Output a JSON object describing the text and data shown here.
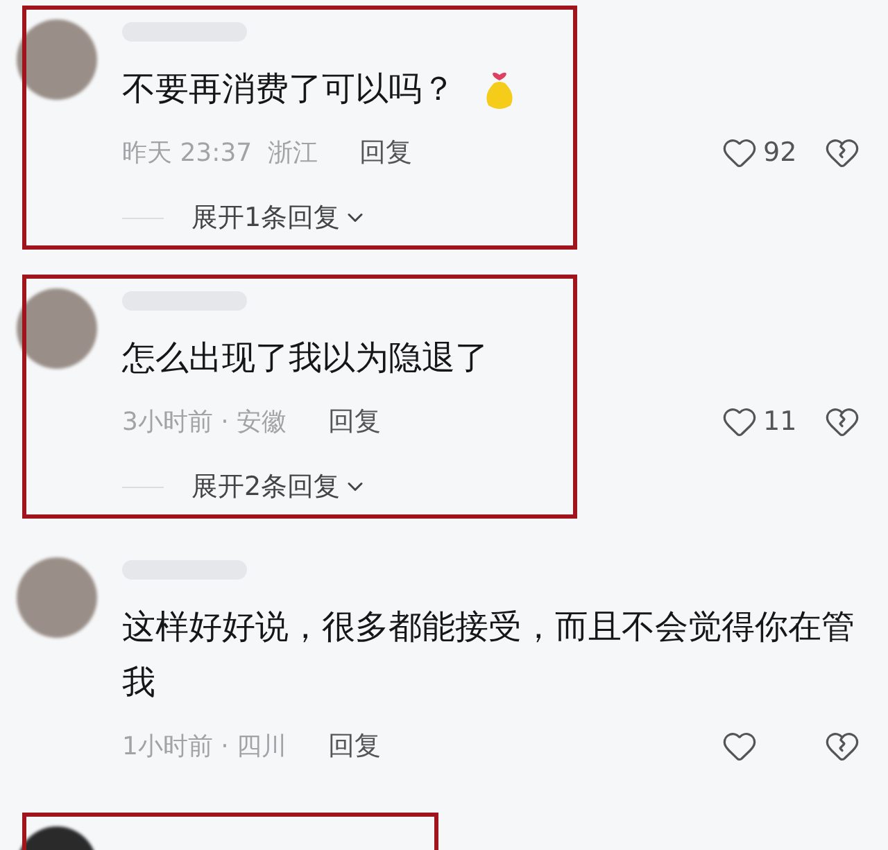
{
  "comments": [
    {
      "kind": "comment",
      "highlighted": true,
      "text": "不要再消费了可以吗？",
      "sticker": true,
      "meta": "昨天 23:37  浙江",
      "reply": "回复",
      "likes": "92",
      "expand": "展开1条回复"
    },
    {
      "kind": "comment",
      "highlighted": true,
      "text": "怎么出现了我以为隐退了",
      "sticker": false,
      "meta": "3小时前 · 安徽",
      "reply": "回复",
      "likes": "11",
      "expand": "展开2条回复"
    },
    {
      "kind": "comment",
      "highlighted": false,
      "text": "这样好好说，很多都能接受，而且不会觉得你在管我",
      "sticker": false,
      "meta": "1小时前 · 四川",
      "reply": "回复"
    },
    {
      "kind": "cut_off",
      "highlighted": true
    }
  ]
}
